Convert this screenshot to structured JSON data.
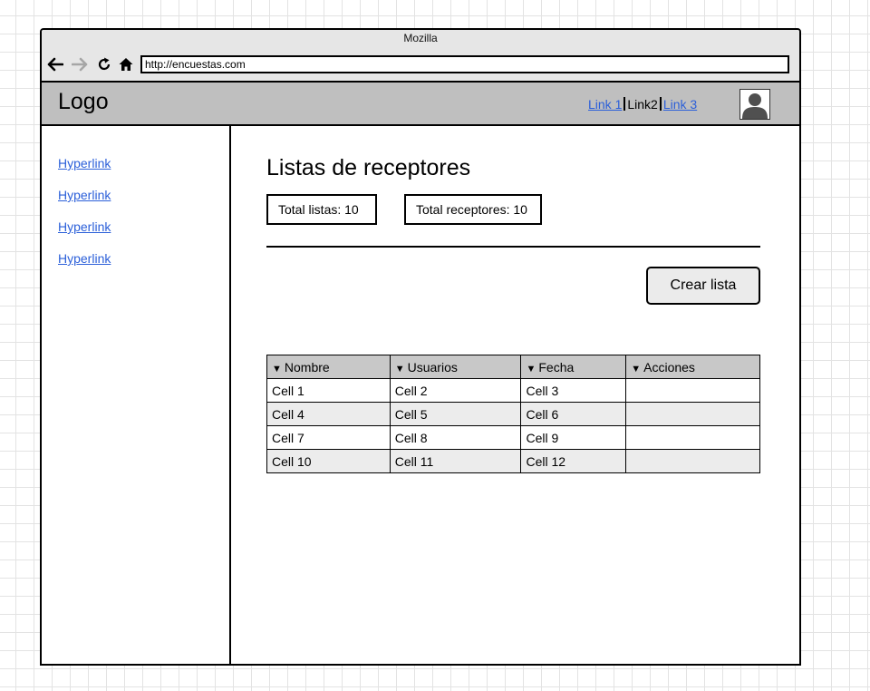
{
  "browser": {
    "title": "Mozilla",
    "url": "http://encuestas.com",
    "icons": [
      "back-arrow-icon",
      "forward-arrow-icon",
      "reload-icon",
      "home-icon"
    ]
  },
  "header": {
    "logo": "Logo",
    "links": [
      "Link 1",
      "Link2",
      "Link 3"
    ],
    "avatar_icon": "user-avatar-icon"
  },
  "sidebar": {
    "links": [
      "Hyperlink",
      "Hyperlink",
      "Hyperlink",
      "Hyperlink"
    ]
  },
  "main": {
    "title": "Listas de receptores",
    "stats": {
      "total_lists": "Total listas: 10",
      "total_receivers": "Total receptores: 10"
    },
    "create_button": "Crear lista",
    "table": {
      "headers": [
        "Nombre",
        "Usuarios",
        "Fecha",
        "Acciones"
      ],
      "rows": [
        [
          "Cell 1",
          "Cell 2",
          "Cell 3",
          ""
        ],
        [
          "Cell 4",
          "Cell 5",
          "Cell 6",
          ""
        ],
        [
          "Cell 7",
          "Cell 8",
          "Cell 9",
          ""
        ],
        [
          "Cell 10",
          "Cell 11",
          "Cell 12",
          ""
        ]
      ]
    }
  },
  "colors": {
    "link": "#2b5fd9",
    "header_bg": "#bfbfbf",
    "titlebar_bg": "#e6e6e6",
    "table_header_bg": "#c8c8c8",
    "row_alt_bg": "#ececec"
  }
}
